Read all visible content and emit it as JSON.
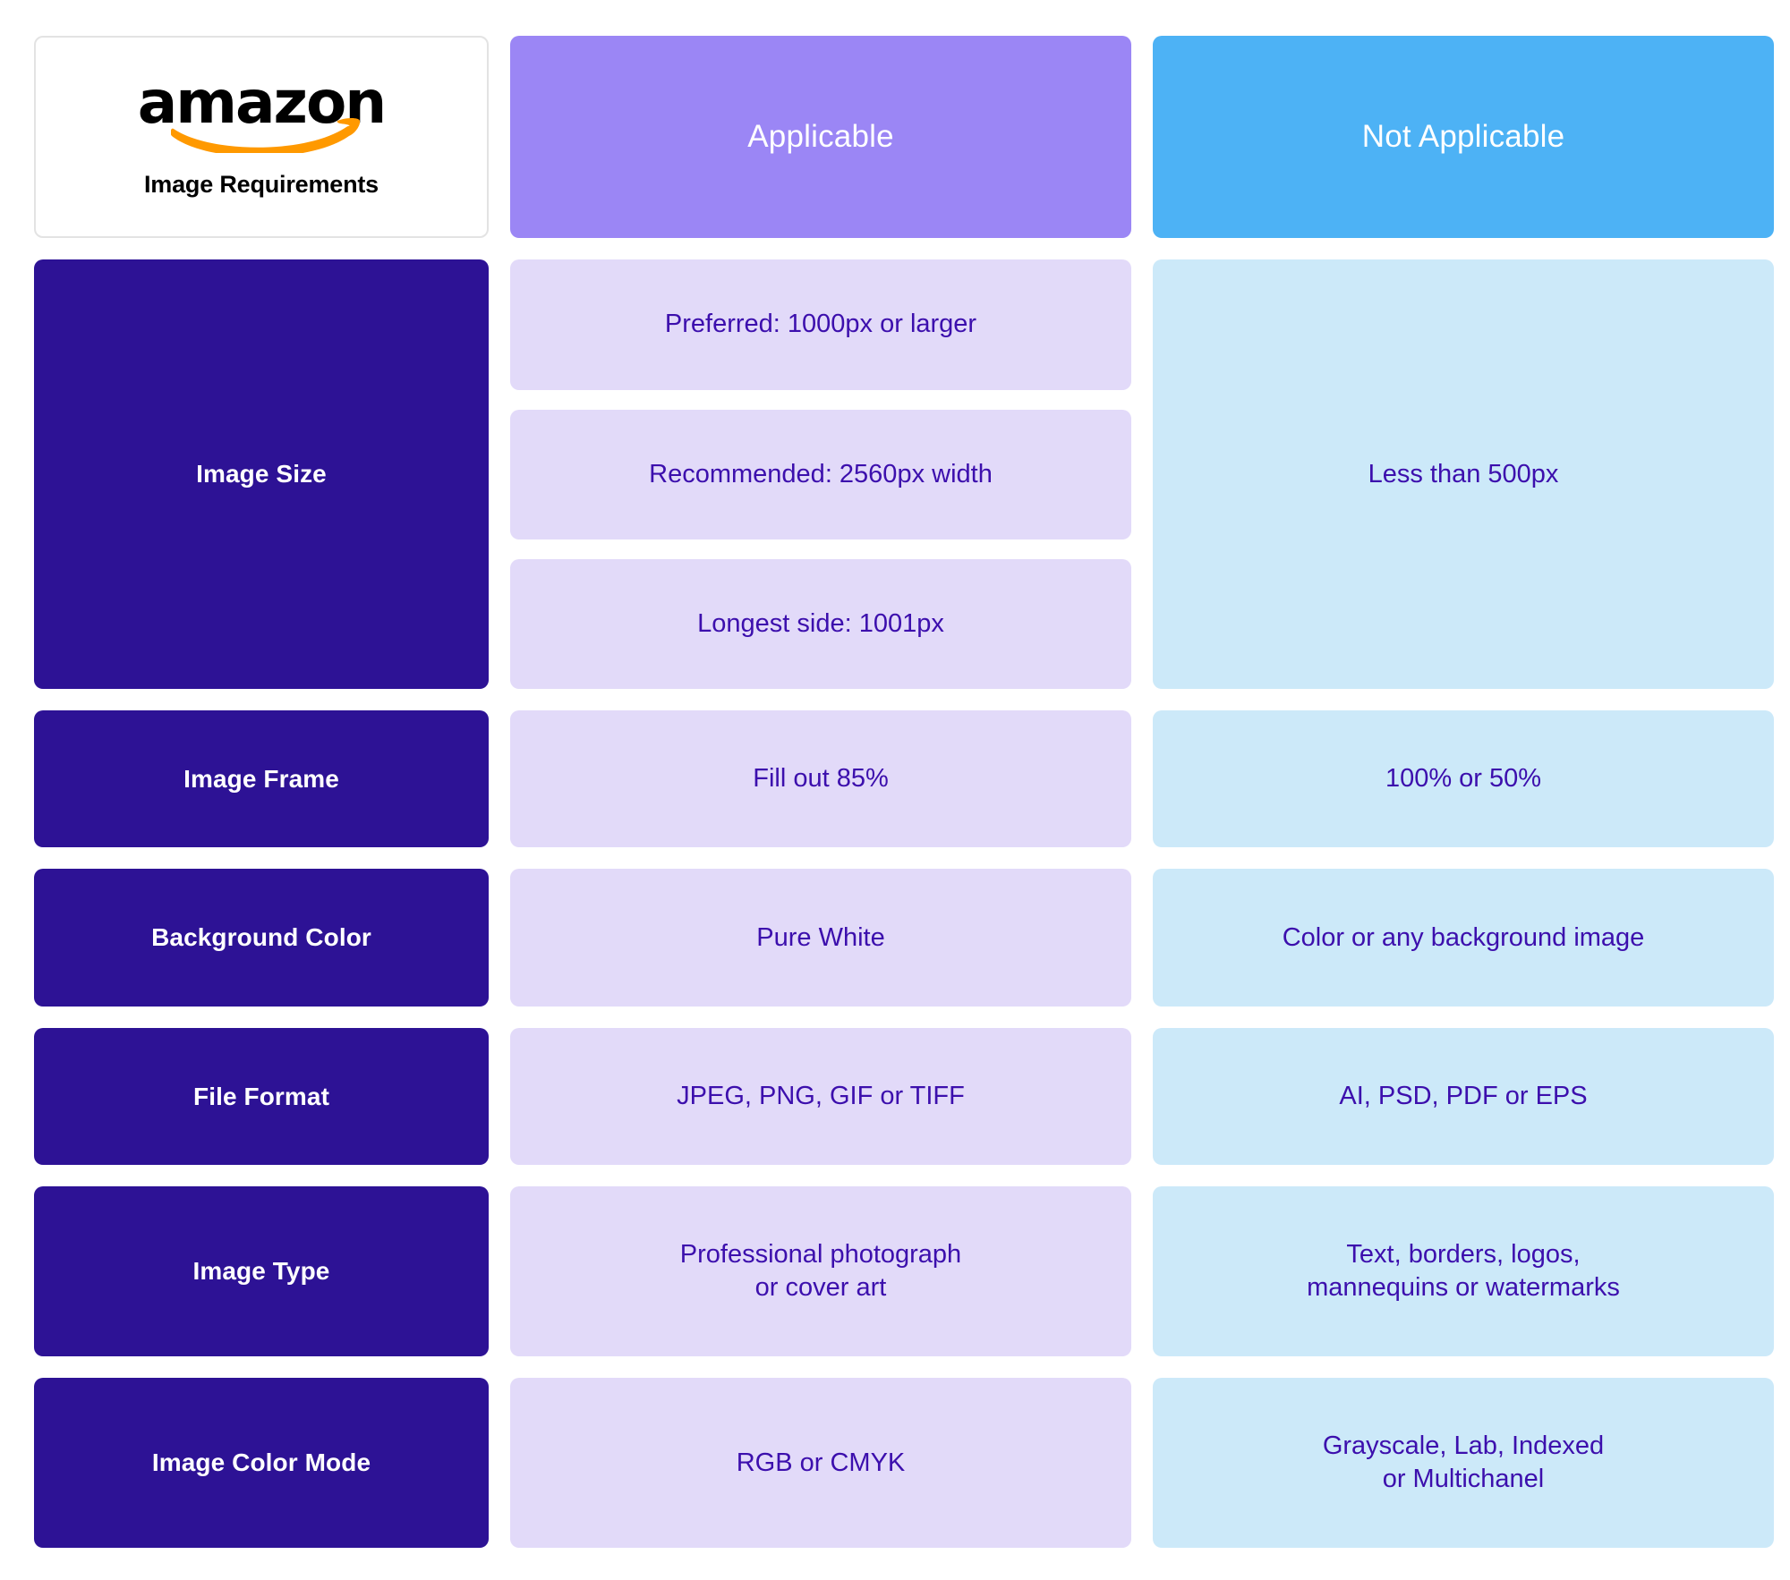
{
  "brand": {
    "logo_word": "amazon",
    "logo_subtitle": "Image Requirements",
    "swoosh_color": "#ff9900"
  },
  "colors": {
    "header_applicable": "#9b86f5",
    "header_not_applicable": "#4db2f5",
    "label_cell": "#2d1295",
    "cell_applicable": "#e2daf9",
    "cell_not_applicable": "#cce9f9",
    "value_text": "#3c0fad",
    "page_background": "#ffffff"
  },
  "header": {
    "applicable": "Applicable",
    "not_applicable": "Not Applicable"
  },
  "rows": [
    {
      "label": "Image Size",
      "applicable": [
        "Preferred: 1000px or larger",
        "Recommended: 2560px width",
        "Longest side: 1001px"
      ],
      "not_applicable": "Less than 500px"
    },
    {
      "label": "Image Frame",
      "applicable": "Fill out 85%",
      "not_applicable": "100% or 50%"
    },
    {
      "label": "Background Color",
      "applicable": "Pure White",
      "not_applicable": "Color or any background image"
    },
    {
      "label": "File Format",
      "applicable": "JPEG, PNG, GIF or TIFF",
      "not_applicable": "AI, PSD, PDF or EPS"
    },
    {
      "label": "Image Type",
      "applicable_line1": "Professional photograph",
      "applicable_line2": "or cover art",
      "not_applicable_line1": "Text, borders, logos,",
      "not_applicable_line2": "mannequins or watermarks"
    },
    {
      "label": "Image Color Mode",
      "applicable": "RGB or CMYK",
      "not_applicable_line1": "Grayscale, Lab, Indexed",
      "not_applicable_line2": "or Multichanel"
    }
  ]
}
